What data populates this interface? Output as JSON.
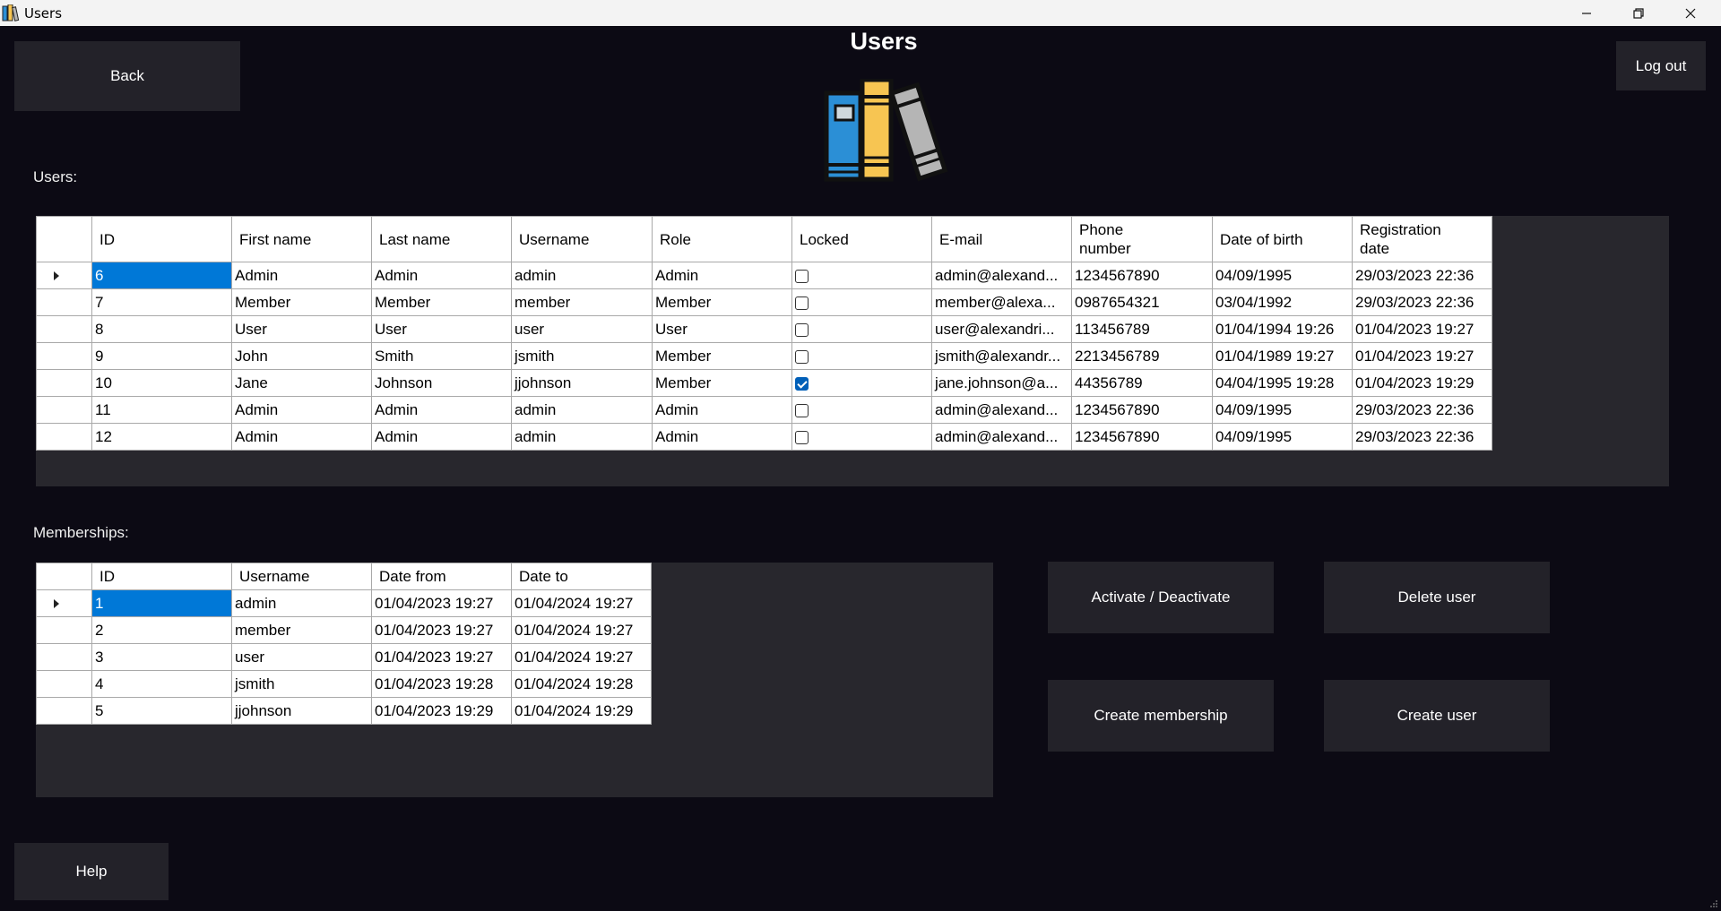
{
  "window": {
    "title": "Users",
    "icon": "books-app-icon",
    "controls": [
      "minimize-icon",
      "restore-icon",
      "close-icon"
    ]
  },
  "header": {
    "title": "Users",
    "logo": "books-logo",
    "back_label": "Back",
    "logout_label": "Log out"
  },
  "users": {
    "label": "Users:",
    "columns": [
      "ID",
      "First name",
      "Last name",
      "Username",
      "Role",
      "Locked",
      "E-mail",
      "Phone\nnumber",
      "Date of birth",
      "Registration\ndate"
    ],
    "rows": [
      {
        "id": "6",
        "first": "Admin",
        "last": "Admin",
        "username": "admin",
        "role": "Admin",
        "locked": false,
        "email": "admin@alexand...",
        "phone": "1234567890",
        "dob": "04/09/1995",
        "reg": "29/03/2023 22:36"
      },
      {
        "id": "7",
        "first": "Member",
        "last": "Member",
        "username": "member",
        "role": "Member",
        "locked": false,
        "email": "member@alexa...",
        "phone": "0987654321",
        "dob": "03/04/1992",
        "reg": "29/03/2023 22:36"
      },
      {
        "id": "8",
        "first": "User",
        "last": "User",
        "username": "user",
        "role": "User",
        "locked": false,
        "email": "user@alexandri...",
        "phone": "113456789",
        "dob": "01/04/1994 19:26",
        "reg": "01/04/2023 19:27"
      },
      {
        "id": "9",
        "first": "John",
        "last": "Smith",
        "username": "jsmith",
        "role": "Member",
        "locked": false,
        "email": "jsmith@alexandr...",
        "phone": "2213456789",
        "dob": "01/04/1989 19:27",
        "reg": "01/04/2023 19:27"
      },
      {
        "id": "10",
        "first": "Jane",
        "last": "Johnson",
        "username": "jjohnson",
        "role": "Member",
        "locked": true,
        "email": "jane.johnson@a...",
        "phone": "44356789",
        "dob": "04/04/1995 19:28",
        "reg": "01/04/2023 19:29"
      },
      {
        "id": "11",
        "first": "Admin",
        "last": "Admin",
        "username": "admin",
        "role": "Admin",
        "locked": false,
        "email": "admin@alexand...",
        "phone": "1234567890",
        "dob": "04/09/1995",
        "reg": "29/03/2023 22:36"
      },
      {
        "id": "12",
        "first": "Admin",
        "last": "Admin",
        "username": "admin",
        "role": "Admin",
        "locked": false,
        "email": "admin@alexand...",
        "phone": "1234567890",
        "dob": "04/09/1995",
        "reg": "29/03/2023 22:36"
      }
    ]
  },
  "memberships": {
    "label": "Memberships:",
    "columns": [
      "ID",
      "Username",
      "Date from",
      "Date to"
    ],
    "rows": [
      {
        "id": "1",
        "username": "admin",
        "from": "01/04/2023 19:27",
        "to": "01/04/2024 19:27"
      },
      {
        "id": "2",
        "username": "member",
        "from": "01/04/2023 19:27",
        "to": "01/04/2024 19:27"
      },
      {
        "id": "3",
        "username": "user",
        "from": "01/04/2023 19:27",
        "to": "01/04/2024 19:27"
      },
      {
        "id": "4",
        "username": "jsmith",
        "from": "01/04/2023 19:28",
        "to": "01/04/2024 19:28"
      },
      {
        "id": "5",
        "username": "jjohnson",
        "from": "01/04/2023 19:29",
        "to": "01/04/2024 19:29"
      }
    ]
  },
  "actions": {
    "activate_label": "Activate / Deactivate",
    "delete_label": "Delete user",
    "create_membership_label": "Create membership",
    "create_user_label": "Create user",
    "help_label": "Help"
  },
  "colors": {
    "background": "#0c0a14",
    "button": "#232229",
    "panel": "#28272d",
    "selection": "#0078d7",
    "logo_blue": "#2b8fd6",
    "logo_yellow": "#f7c552",
    "logo_grey": "#b5b5b5"
  }
}
